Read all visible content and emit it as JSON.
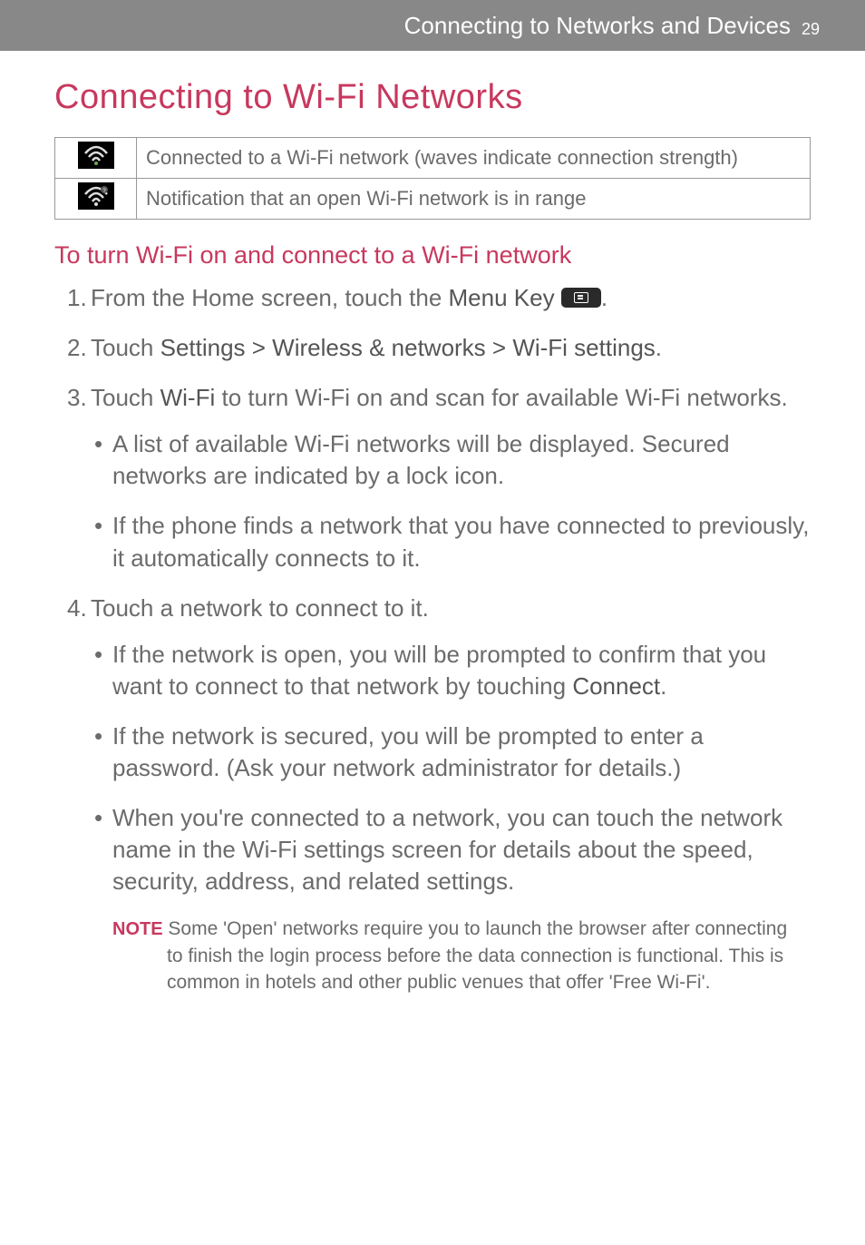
{
  "header": {
    "title": "Connecting to Networks and Devices",
    "page_number": "29"
  },
  "section_title": "Connecting to Wi-Fi Networks",
  "icon_table": {
    "rows": [
      {
        "icon_name": "wifi-connected-icon",
        "desc": "Connected to a Wi-Fi network (waves indicate connection strength)"
      },
      {
        "icon_name": "wifi-open-available-icon",
        "desc": "Notification that an open Wi-Fi network is in range"
      }
    ]
  },
  "subsection_title": "To turn Wi-Fi on and connect to a Wi-Fi network",
  "steps": [
    {
      "num": "1.",
      "pre": "From the Home screen, touch the ",
      "bold": "Menu Key",
      "post": " ",
      "has_icon": true,
      "trail": "."
    },
    {
      "num": "2.",
      "pre": "Touch ",
      "bold": "Settings > Wireless & networks > Wi-Fi settings",
      "post": "."
    },
    {
      "num": "3.",
      "pre": "Touch ",
      "bold": "Wi-Fi",
      "post": " to turn Wi-Fi on and scan for available Wi-Fi networks.",
      "bullets": [
        "A list of available Wi-Fi networks will be displayed. Secured networks are indicated by a lock icon.",
        "If the phone finds a network that you have connected to previously, it automatically connects to it."
      ]
    },
    {
      "num": "4.",
      "pre": "Touch a network to connect to it.",
      "bullets_complex": [
        {
          "pre": "If the network is open, you will be prompted to confirm that you want to connect to that network by touching ",
          "bold": "Connect",
          "post": "."
        },
        {
          "pre": "If the network is secured, you will be prompted to enter a password. (Ask your network administrator for details.)"
        },
        {
          "pre": "When you're connected to a network, you can touch the network name in the Wi-Fi settings screen for details about the speed, security, address, and related settings."
        }
      ]
    }
  ],
  "note": {
    "label": "NOTE",
    "text": " Some 'Open' networks require you to launch the browser after connecting to finish the login process before the data connection is functional. This is common in hotels and other public venues that offer 'Free Wi-Fi'."
  }
}
